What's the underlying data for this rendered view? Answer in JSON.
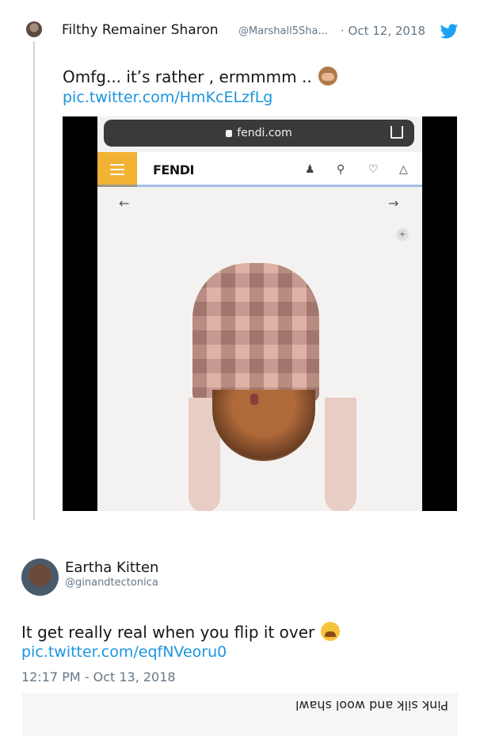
{
  "tweet1": {
    "display_name": "Filthy Remainer Sharon",
    "handle": "@Marshall5Sha...",
    "date": "· Oct 12, 2018",
    "text": "Omfg... it’s rather , ermmmm ..",
    "emoji": "see-no-evil-monkey",
    "link": "pic.twitter.com/HmKcELzfLg"
  },
  "media": {
    "url": "fendi.com",
    "brand": "FENDI",
    "nav_icons": [
      "user-icon",
      "search-icon",
      "heart-icon",
      "bag-icon"
    ],
    "back_arrow": "←",
    "forward_arrow": "→",
    "plus": "+"
  },
  "tweet2": {
    "display_name": "Eartha Kitten",
    "handle": "@ginandtectonica",
    "text": "It get really real when you flip it over",
    "emoji": "crying-face",
    "link": "pic.twitter.com/eqfNVeoru0",
    "timestamp": "12:17 PM - Oct 13, 2018",
    "caption_upside_down": "Pink silk and wool shawl"
  },
  "colors": {
    "link": "#1b95e0",
    "secondary": "#657786",
    "fendi_yellow": "#f2b233",
    "thread": "#ccd6dd"
  }
}
